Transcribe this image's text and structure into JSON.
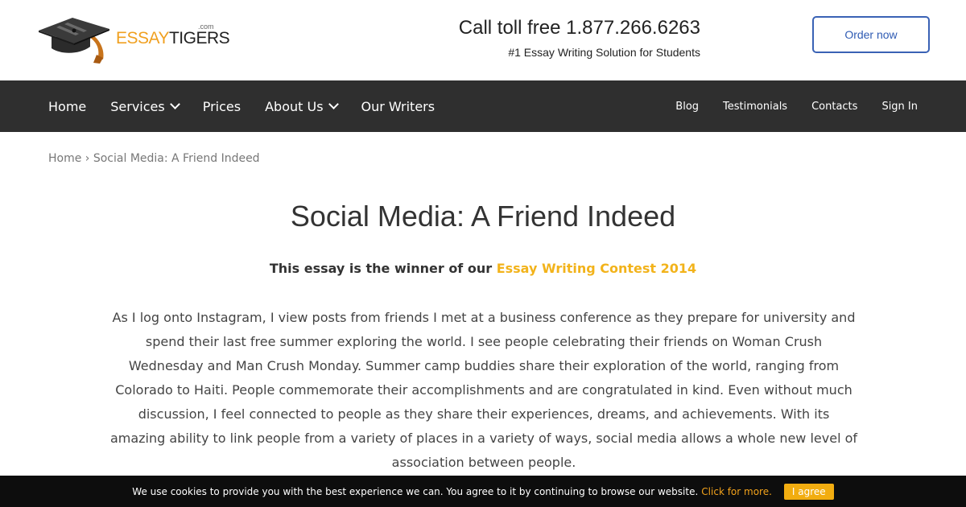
{
  "header": {
    "logo_essay": "ESSAY",
    "logo_tigers": "TIGERS",
    "logo_com": ".com",
    "phone": "Call toll free 1.877.266.6263",
    "tagline": "#1 Essay Writing Solution for Students",
    "order_label": "Order now"
  },
  "nav": {
    "items": [
      {
        "label": "Home"
      },
      {
        "label": "Services"
      },
      {
        "label": "Prices"
      },
      {
        "label": "About Us"
      },
      {
        "label": "Our Writers"
      }
    ],
    "secondary": [
      {
        "label": "Blog"
      },
      {
        "label": "Testimonials"
      },
      {
        "label": "Contacts"
      },
      {
        "label": "Sign In"
      }
    ]
  },
  "breadcrumb": {
    "home": "Home",
    "separator": "›",
    "current": "Social Media: A Friend Indeed"
  },
  "article": {
    "title": "Social Media: A Friend Indeed",
    "winner_prefix": "This essay is the winner of our",
    "winner_link": "Essay Writing Contest 2014",
    "paragraph": "As I log onto Instagram, I view posts from friends I met at a business conference as they prepare for university and spend their last free summer exploring the world. I see people celebrating their friends on Woman Crush Wednesday and Man Crush Monday. Summer camp buddies share their exploration of the world, ranging from Colorado to Haiti. People commemorate their accomplishments and are congratulated in kind. Even without much discussion, I feel connected to people as they share their experiences, dreams, and achievements. With its amazing ability to link people from a variety of places in a variety of ways, social media allows a whole new level of association between people."
  },
  "cookie": {
    "text": "We use cookies to provide you with the best experience we can. You agree to it by continuing to browse our website.",
    "link": "Click for more.",
    "button": "I agree"
  },
  "colors": {
    "accent_orange": "#f2b31b",
    "nav_bg": "#2f2f2f",
    "button_blue": "#3a62b5",
    "cookie_bg": "#0d0d0d"
  }
}
